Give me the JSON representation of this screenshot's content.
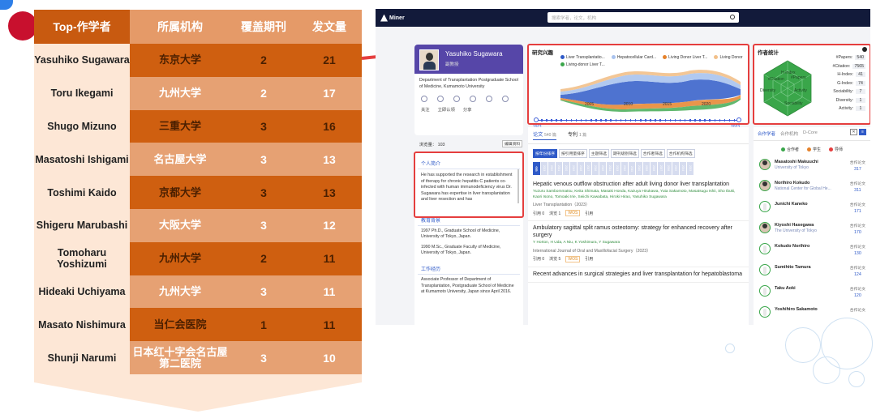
{
  "ranking": {
    "headers": [
      "Top-作学者",
      "所属机构",
      "覆盖期刊",
      "发文量"
    ],
    "rows": [
      {
        "name": "Yasuhiko Sugawara",
        "org": "东京大学",
        "journals": "2",
        "papers": "21"
      },
      {
        "name": "Toru Ikegami",
        "org": "九州大学",
        "journals": "2",
        "papers": "17"
      },
      {
        "name": "Shugo Mizuno",
        "org": "三重大学",
        "journals": "3",
        "papers": "16"
      },
      {
        "name": "Masatoshi Ishigami",
        "org": "名古屋大学",
        "journals": "3",
        "papers": "13"
      },
      {
        "name": "Toshimi Kaido",
        "org": "京都大学",
        "journals": "3",
        "papers": "13"
      },
      {
        "name": "Shigeru Marubashi",
        "org": "大阪大学",
        "journals": "3",
        "papers": "12"
      },
      {
        "name": "Tomoharu Yoshizumi",
        "org": "九州大学",
        "journals": "2",
        "papers": "11"
      },
      {
        "name": "Hideaki Uchiyama",
        "org": "九州大学",
        "journals": "3",
        "papers": "11"
      },
      {
        "name": "Masato Nishimura",
        "org": "当仁会医院",
        "journals": "1",
        "papers": "11"
      },
      {
        "name": "Shunji Narumi",
        "org": "日本红十字会名古屋第二医院",
        "journals": "3",
        "papers": "10"
      }
    ]
  },
  "aminer": {
    "logo": "Miner",
    "search_placeholder": "搜索学者，论文，机构",
    "profile": {
      "name": "Yasuhiko Sugawara",
      "title": "副教授",
      "affiliation": "Department of Transplantation Postgraduate School of Medicine, Kumamoto University",
      "actions": [
        "关注",
        "立即认领",
        "分享"
      ],
      "views_label": "浏览量： 103",
      "edit_label": "编辑资料"
    },
    "bio": {
      "section_title": "个人简介",
      "text": "He has supported the research in establishment of therapy for chronic hepatitis C patients co-infected with human immunodeficiency virus Dr. Sugawara has expertise in liver transplantation and liver resection and has",
      "edu_title": "教育背景",
      "edu": [
        "1997 Ph.D., Graduate School of Medicine, University of Tokyo, Japan.",
        "1990 M.Sc., Graduate Faculty of Medicine, University of Tokyo, Japan."
      ],
      "work_title": "工作经历",
      "work": "Associate Professor of Department of Transplantation, Postgraduate School of Medicine at Kumamoto University, Japan since April 2016."
    },
    "research": {
      "title": "研究兴趣",
      "legend": [
        {
          "label": "Liver Transplantatio...",
          "color": "#2f5ac8"
        },
        {
          "label": "Hepatocellular Card...",
          "color": "#a9c3ee"
        },
        {
          "label": "Living Donor Liver T...",
          "color": "#e5822b"
        },
        {
          "label": "Living Donor",
          "color": "#f2c089"
        },
        {
          "label": "Living-donor Liver T...",
          "color": "#3aa64a"
        }
      ],
      "x_ticks": [
        "2005",
        "2010",
        "2015",
        "2020"
      ],
      "range_start": "1971",
      "range_end": "2023"
    },
    "stats": {
      "title": "作者统计",
      "items": [
        {
          "label": "#Papers:",
          "value": "540"
        },
        {
          "label": "#Citation:",
          "value": "7565"
        },
        {
          "label": "H-Index:",
          "value": "41"
        },
        {
          "label": "G-Index:",
          "value": "74"
        },
        {
          "label": "Sociability:",
          "value": "7"
        },
        {
          "label": "Diversity:",
          "value": "1"
        },
        {
          "label": "Activity:",
          "value": "1"
        }
      ],
      "radar_labels": [
        "H-Index",
        "#Papers",
        "Activity",
        "Sociability",
        "Diversity",
        "#Citation"
      ]
    },
    "papers": {
      "tab_papers": "论文",
      "tab_papers_count": "540 篇",
      "tab_patents": "专利",
      "tab_patents_count": "1 篇",
      "filters": [
        "按年份排序",
        "按引用量排序",
        "主题筛选",
        "期刊级别筛选",
        "合作者筛选",
        "合作机构筛选"
      ],
      "year_all": "全部",
      "years": [
        "2023",
        "2022",
        "2021",
        "2020",
        "2019",
        "2018",
        "2017",
        "2016",
        "2015",
        "2014",
        "2013",
        "2012",
        "2011",
        "2010",
        "2009",
        "2008",
        "2007",
        "2006",
        "2005",
        "2004",
        "2003"
      ],
      "items": [
        {
          "title": "Hepatic venous outflow obstruction after adult living donor liver transplantation",
          "authors": "Yuzuru Sambommatsu, Keita Shimata, Masaki Honda, Kazuya Hirukawa, Yuta Sakamoto, Masatsugu Ishii, Sho Ibuki, Kaori Isono, Tomoaki Irie, Seiichi Kawabata, Hiroki Hirao, Yasuhiko Sugawara",
          "venue": "Liver Transplantation（2023）",
          "cited": "引用 0",
          "views": "浏览 1",
          "tag": "WOS",
          "cite": "引用"
        },
        {
          "title": "Ambulatory sagittal split ramus osteotomy: strategy for enhanced recovery after surgery",
          "authors": "Y Horton, H Uda, A Niu, K Yoshimura, Y Sugawara",
          "venue": "International Journal of Oral and Maxillofacial Surgery（2023）",
          "cited": "引用 0",
          "views": "浏览 5",
          "tag": "WOS",
          "cite": "引用"
        },
        {
          "title": "Recent advances in surgical strategies and liver transplantation for hepatoblastoma",
          "authors": "",
          "venue": "",
          "cited": "",
          "views": "",
          "tag": "",
          "cite": ""
        }
      ]
    },
    "coauthors": {
      "tabs": [
        "合作学者",
        "合作机构",
        "D-Core"
      ],
      "legend": [
        {
          "label": "合作者",
          "color": "#3aa64a"
        },
        {
          "label": "学生",
          "color": "#e5822b"
        },
        {
          "label": "导师",
          "color": "#e53e3e"
        }
      ],
      "count_label": "合作论文",
      "items": [
        {
          "name": "Masatoshi Makuuchi",
          "org": "University of Tokyo",
          "count": "317",
          "photo": true
        },
        {
          "name": "Norihiro Kokudo",
          "org": "National Center for Global He...",
          "count": "311",
          "photo": true
        },
        {
          "name": "Junichi Kaneko",
          "org": "",
          "count": "171",
          "photo": false
        },
        {
          "name": "Kiyoshi Hasegawa",
          "org": "The University of Tokyo",
          "count": "170",
          "photo": true
        },
        {
          "name": "Kokudo Norihiro",
          "org": "",
          "count": "130",
          "photo": false
        },
        {
          "name": "Sumihito Tamura",
          "org": "",
          "count": "124",
          "photo": false
        },
        {
          "name": "Taku Aoki",
          "org": "",
          "count": "120",
          "photo": false
        },
        {
          "name": "Yoshihiro Sakamoto",
          "org": "",
          "count": "",
          "photo": false
        }
      ]
    }
  }
}
